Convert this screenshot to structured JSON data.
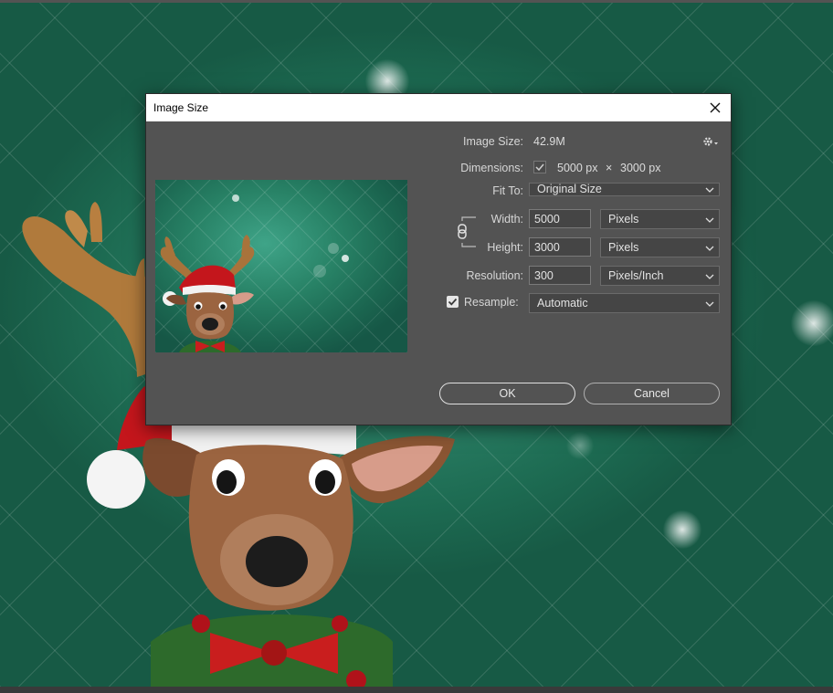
{
  "dialog": {
    "title": "Image Size",
    "image_size_label": "Image Size:",
    "image_size_value": "42.9M",
    "dimensions_label": "Dimensions:",
    "dim_width": "5000 px",
    "dim_x": "×",
    "dim_height": "3000 px",
    "fit_to_label": "Fit To:",
    "fit_to_value": "Original Size",
    "width_label": "Width:",
    "width_value": "5000",
    "width_unit": "Pixels",
    "height_label": "Height:",
    "height_value": "3000",
    "height_unit": "Pixels",
    "resolution_label": "Resolution:",
    "resolution_value": "300",
    "resolution_unit": "Pixels/Inch",
    "resample_label": "Resample:",
    "resample_checked": true,
    "resample_value": "Automatic",
    "ok_label": "OK",
    "cancel_label": "Cancel"
  },
  "colors": {
    "dialog_bg": "#535353",
    "canvas_green": "#2b8066",
    "field_bg": "#454545"
  },
  "icons": [
    "close-icon",
    "gear-icon",
    "chain-link-icon",
    "checkmark-icon",
    "chevron-down-icon"
  ]
}
